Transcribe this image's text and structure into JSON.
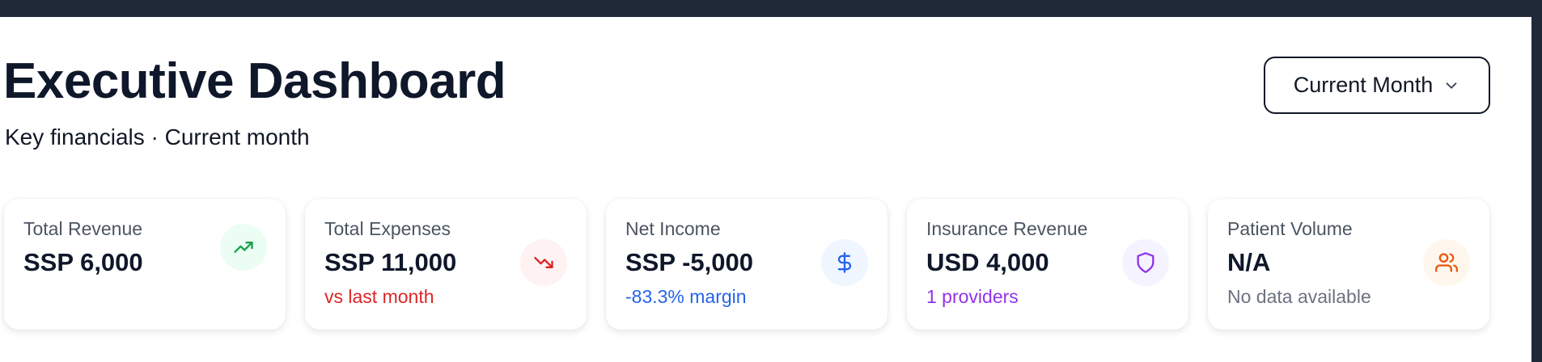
{
  "header": {
    "title": "Executive Dashboard",
    "subtitle": "Key financials · Current month",
    "period_select": {
      "value": "Current Month",
      "icon": "chevron-down-icon"
    }
  },
  "cards": [
    {
      "label": "Total Revenue",
      "value": "SSP 6,000",
      "sub": "",
      "icon": "trending-up-icon",
      "icon_color": "#16a34a",
      "icon_bg": "#ecfdf3"
    },
    {
      "label": "Total Expenses",
      "value": "SSP 11,000",
      "sub": "vs last month",
      "sub_color": "#dc2626",
      "icon": "trending-down-icon",
      "icon_color": "#dc2626",
      "icon_bg": "#fef2f2"
    },
    {
      "label": "Net Income",
      "value": "SSP -5,000",
      "sub": "-83.3% margin",
      "sub_color": "#2563eb",
      "icon": "dollar-icon",
      "icon_color": "#2563eb",
      "icon_bg": "#eff6ff"
    },
    {
      "label": "Insurance Revenue",
      "value": "USD 4,000",
      "sub": "1 providers",
      "sub_color": "#9333ea",
      "icon": "shield-icon",
      "icon_color": "#9333ea",
      "icon_bg": "#f5f3ff"
    },
    {
      "label": "Patient Volume",
      "value": "N/A",
      "sub": "No data available",
      "sub_color": "#6b7280",
      "icon": "users-icon",
      "icon_color": "#ea580c",
      "icon_bg": "#fff7ed"
    }
  ]
}
